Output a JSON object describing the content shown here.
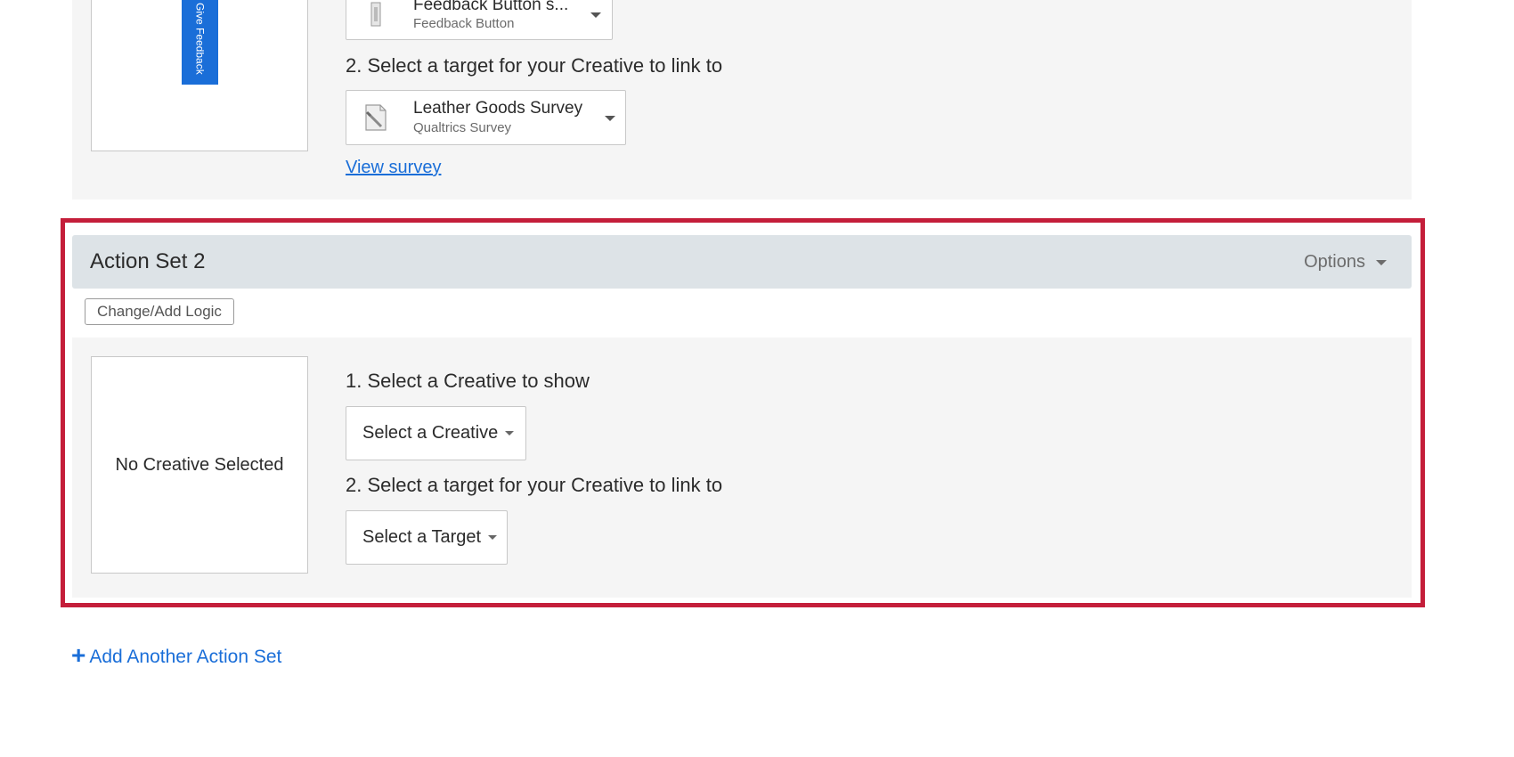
{
  "action_set_1": {
    "feedback_tab_text": "Give Feedback",
    "creative_dropdown": {
      "title": "Feedback Button s...",
      "subtitle": "Feedback Button",
      "icon": "feedback-button-icon"
    },
    "step2_label": "2. Select a target for your Creative to link to",
    "target_dropdown": {
      "title": "Leather Goods Survey",
      "subtitle": "Qualtrics Survey",
      "icon": "survey-pencil-icon"
    },
    "view_survey_link": "View survey"
  },
  "action_set_2": {
    "title": "Action Set 2",
    "options_label": "Options",
    "change_logic_label": "Change/Add Logic",
    "preview_text": "No Creative Selected",
    "step1_label": "1. Select a Creative to show",
    "select_creative_label": "Select a Creative",
    "step2_label": "2. Select a target for your Creative to link to",
    "select_target_label": "Select a Target"
  },
  "add_action_set_label": "Add Another Action Set",
  "colors": {
    "accent": "#1a6ed8",
    "highlight": "#c41e3a",
    "panel_bg": "#f5f5f5",
    "header_bg": "#dde3e7"
  }
}
